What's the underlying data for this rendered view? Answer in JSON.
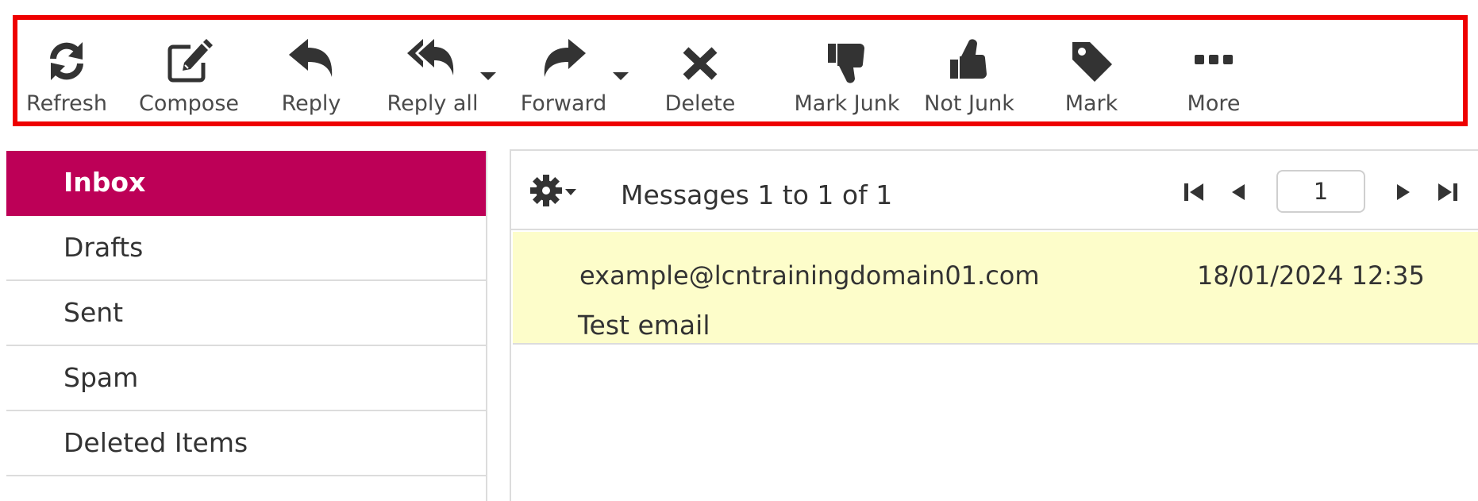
{
  "toolbar": {
    "refresh": {
      "label": "Refresh",
      "icon": "refresh-icon"
    },
    "compose": {
      "label": "Compose",
      "icon": "compose-icon"
    },
    "reply": {
      "label": "Reply",
      "icon": "reply-icon"
    },
    "reply_all": {
      "label": "Reply all",
      "icon": "reply-all-icon"
    },
    "forward": {
      "label": "Forward",
      "icon": "forward-icon"
    },
    "delete": {
      "label": "Delete",
      "icon": "delete-icon"
    },
    "mark_junk": {
      "label": "Mark Junk",
      "icon": "thumbs-down-icon"
    },
    "not_junk": {
      "label": "Not Junk",
      "icon": "thumbs-up-icon"
    },
    "mark": {
      "label": "Mark",
      "icon": "tag-icon"
    },
    "more": {
      "label": "More",
      "icon": "more-icon"
    },
    "highlight_color": "#ee0000",
    "icon_color": "#333333"
  },
  "folders": {
    "items": [
      {
        "label": "Inbox",
        "selected": true
      },
      {
        "label": "Drafts",
        "selected": false
      },
      {
        "label": "Sent",
        "selected": false
      },
      {
        "label": "Spam",
        "selected": false
      },
      {
        "label": "Deleted Items",
        "selected": false
      }
    ],
    "selected_color": "#bd0057"
  },
  "message_list": {
    "count_text": "Messages 1 to 1 of 1",
    "page": "1",
    "messages": [
      {
        "from": "example@lcntrainingdomain01.com",
        "date": "18/01/2024 12:35",
        "subject": "Test email"
      }
    ],
    "row_highlight_color": "#fdfdca"
  }
}
